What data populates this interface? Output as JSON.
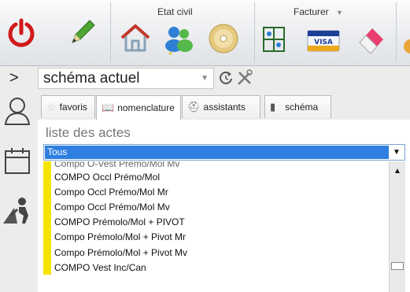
{
  "toolbar": {
    "groups": {
      "etat_civil": "Etat civil",
      "facturer": "Facturer"
    },
    "icons": [
      "power-icon",
      "pencil-icon",
      "home-icon",
      "patients-icon",
      "disc-icon",
      "dental-chart-icon",
      "visa-card-icon",
      "eraser-icon",
      "more-icon"
    ]
  },
  "nav": {
    "chevron": ">",
    "schema_value": "schéma actuel"
  },
  "tabs": [
    {
      "label": "favoris"
    },
    {
      "label": "nomenclature"
    },
    {
      "label": "assistants"
    },
    {
      "label": "schéma"
    }
  ],
  "list": {
    "title": "liste des actes",
    "filter_value": "Tous",
    "items": [
      "Compo O-Vest Prémo/Mol Mv",
      "COMPO Occl Prémo/Mol",
      "Compo Occl Prémo/Mol Mr",
      "Compo Occl Prémo/Mol Mv",
      "COMPO Prémolo/Mol + PIVOT",
      "Compo Prémolo/Mol + Pivot Mr",
      "Compo Prémolo/Mol + Pivot Mv",
      "COMPO Vest Inc/Can"
    ]
  },
  "colors": {
    "accent": "#2f7fe0",
    "marker": "#f5e400",
    "power_red": "#d11a1a"
  }
}
